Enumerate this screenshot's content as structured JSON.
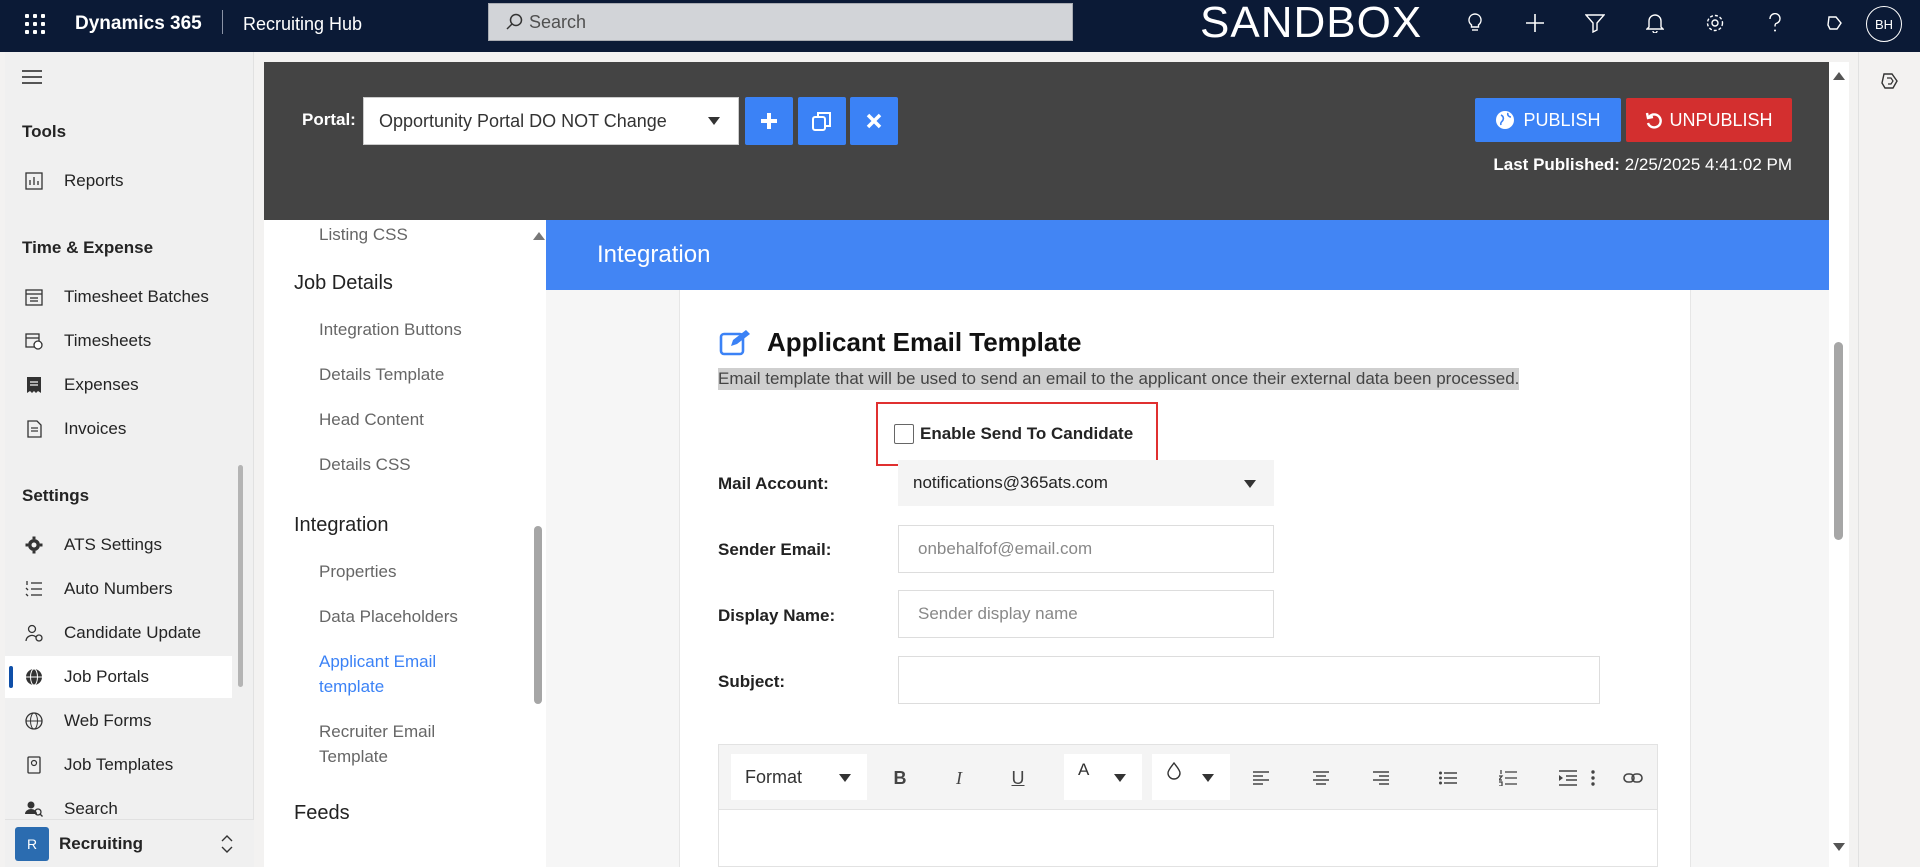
{
  "topbar": {
    "brand": "Dynamics 365",
    "app_name": "Recruiting Hub",
    "search_placeholder": "Search",
    "environment": "SANDBOX",
    "user_initials": "BH"
  },
  "leftnav": {
    "groups": [
      {
        "title": "Tools",
        "items": [
          {
            "label": "Reports",
            "icon": "reports-icon"
          }
        ]
      },
      {
        "title": "Time & Expense",
        "items": [
          {
            "label": "Timesheet Batches",
            "icon": "calendar-icon"
          },
          {
            "label": "Timesheets",
            "icon": "timesheet-icon"
          },
          {
            "label": "Expenses",
            "icon": "receipt-icon"
          },
          {
            "label": "Invoices",
            "icon": "invoice-icon"
          }
        ]
      },
      {
        "title": "Settings",
        "items": [
          {
            "label": "ATS Settings",
            "icon": "gear-icon"
          },
          {
            "label": "Auto Numbers",
            "icon": "numbered-list-icon"
          },
          {
            "label": "Candidate Update",
            "icon": "person-update-icon"
          },
          {
            "label": "Job Portals",
            "icon": "globe-icon",
            "selected": true
          },
          {
            "label": "Web Forms",
            "icon": "form-icon"
          },
          {
            "label": "Job Templates",
            "icon": "template-icon"
          },
          {
            "label": "Search",
            "icon": "search-people-icon"
          }
        ]
      }
    ],
    "area": {
      "badge": "R",
      "label": "Recruiting"
    }
  },
  "portal": {
    "label": "Portal:",
    "selected": "Opportunity Portal DO NOT Change",
    "publish_label": "PUBLISH",
    "unpublish_label": "UNPUBLISH",
    "last_published_label": "Last Published:",
    "last_published_value": "2/25/2025 4:41:02 PM"
  },
  "inner_nav": {
    "listing_css": "Listing CSS",
    "job_details": {
      "title": "Job Details",
      "items": [
        "Integration Buttons",
        "Details Template",
        "Head Content",
        "Details CSS"
      ]
    },
    "integration": {
      "title": "Integration",
      "items": [
        "Properties",
        "Data Placeholders"
      ],
      "active_line1": "Applicant Email",
      "active_line2": "template",
      "recruiter_line1": "Recruiter Email",
      "recruiter_line2": "Template"
    },
    "feeds": "Feeds"
  },
  "section": {
    "title": "Integration"
  },
  "card": {
    "title": "Applicant Email Template",
    "description": "Email template that will be used to send an email to the applicant once their external data been processed.",
    "enable_label": "Enable Send To Candidate",
    "enable_checked": false,
    "mail_account_label": "Mail Account:",
    "mail_account_value": "notifications@365ats.com",
    "sender_email_label": "Sender Email:",
    "sender_email_placeholder": "onbehalfof@email.com",
    "display_name_label": "Display Name:",
    "display_name_placeholder": "Sender display name",
    "subject_label": "Subject:",
    "subject_value": ""
  },
  "editor": {
    "format_label": "Format",
    "font_color_glyph": "A",
    "bold": "B",
    "italic": "I",
    "underline": "U"
  },
  "colors": {
    "topbar_bg": "#0b1a36",
    "accent_blue": "#3b82f6",
    "section_blue": "#4285f4",
    "danger_red": "#d32f2f",
    "header_gray": "#444444"
  }
}
